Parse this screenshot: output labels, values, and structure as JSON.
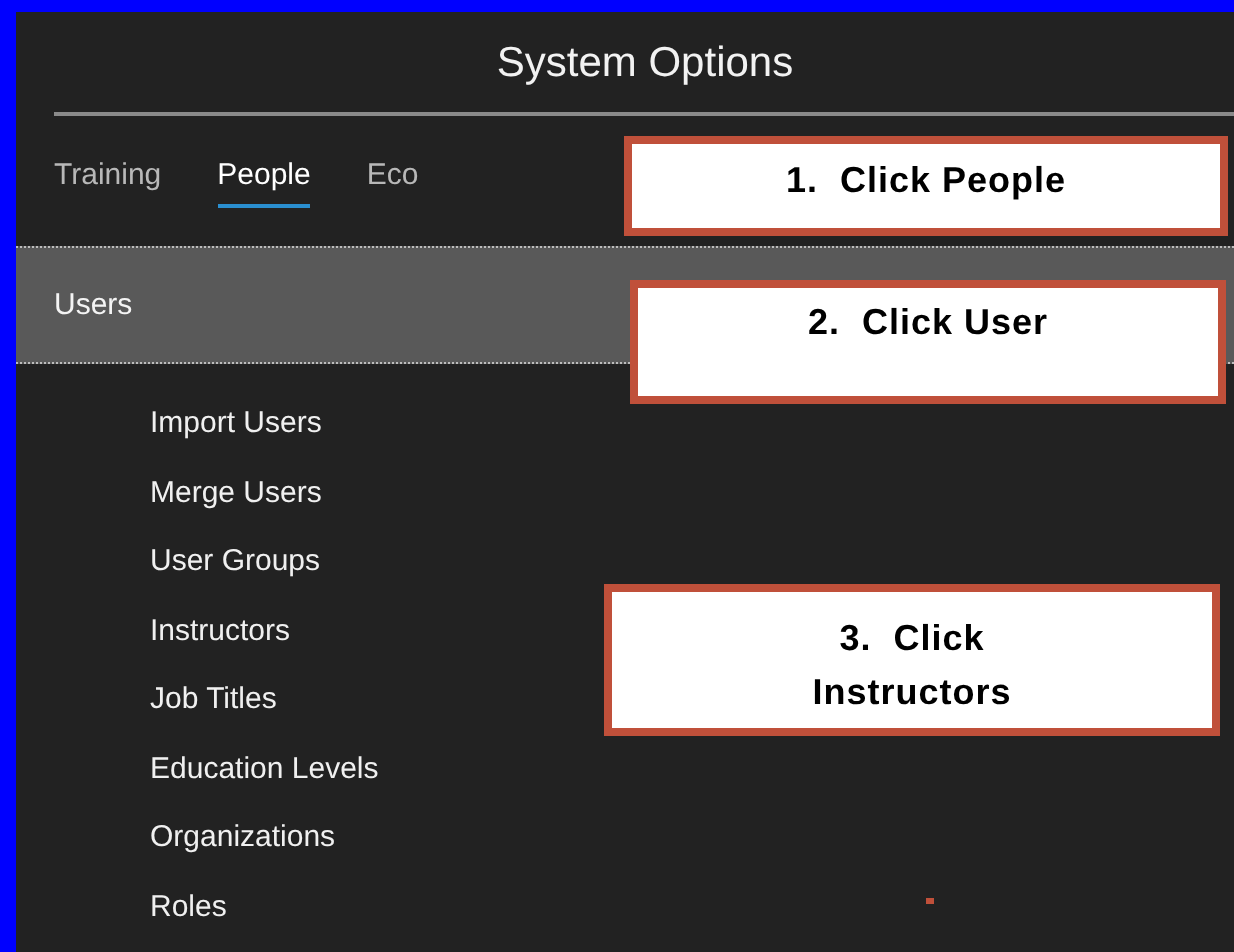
{
  "window": {
    "title": "System Options"
  },
  "tabs": [
    {
      "label": "Training",
      "selected": false
    },
    {
      "label": "People",
      "selected": true
    },
    {
      "label": "Eco",
      "selected": false
    }
  ],
  "section": {
    "label": "Users",
    "selected": true
  },
  "items": [
    "Import Users",
    "Merge Users",
    "User Groups",
    "Instructors",
    "Job Titles",
    "Education Levels",
    "Organizations",
    "Roles"
  ],
  "callouts": [
    "1.  Click People",
    "2.  Click User",
    "3.  Click Instructors"
  ]
}
